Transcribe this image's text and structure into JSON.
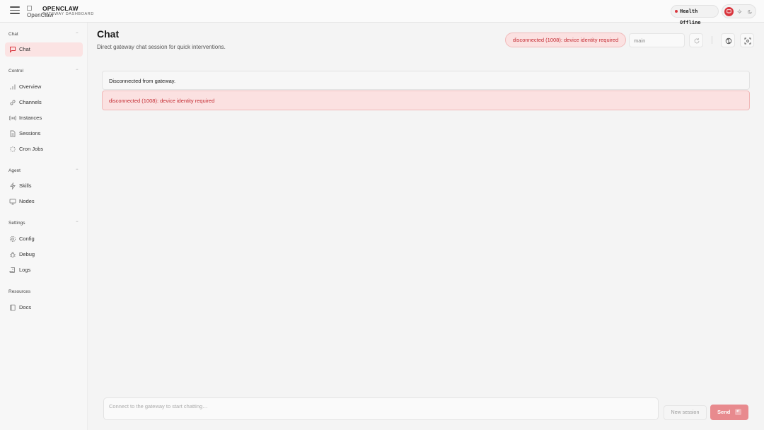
{
  "header": {
    "brand_alt": "OpenClaw",
    "brand_title": "OPENCLAW",
    "brand_subtitle": "GATEWAY DASHBOARD",
    "health_label": "Health Offline"
  },
  "sidebar": {
    "groups": [
      {
        "label": "Chat",
        "chevron": "−"
      },
      {
        "label": "Control",
        "chevron": "−"
      },
      {
        "label": "Agent",
        "chevron": "−"
      },
      {
        "label": "Settings",
        "chevron": "−"
      },
      {
        "label": "Resources"
      }
    ],
    "items": [
      {
        "label": "Chat",
        "icon": "message-square-icon",
        "active": true
      },
      {
        "label": "Overview",
        "icon": "bar-chart-icon"
      },
      {
        "label": "Channels",
        "icon": "link-icon"
      },
      {
        "label": "Instances",
        "icon": "radio-icon"
      },
      {
        "label": "Sessions",
        "icon": "file-text-icon"
      },
      {
        "label": "Cron Jobs",
        "icon": "loader-icon"
      },
      {
        "label": "Skills",
        "icon": "zap-icon"
      },
      {
        "label": "Nodes",
        "icon": "monitor-icon"
      },
      {
        "label": "Config",
        "icon": "settings-icon"
      },
      {
        "label": "Debug",
        "icon": "bug-icon"
      },
      {
        "label": "Logs",
        "icon": "scroll-icon"
      },
      {
        "label": "Docs",
        "icon": "book-icon"
      }
    ]
  },
  "main": {
    "title": "Chat",
    "subtitle": "Direct gateway chat session for quick interventions.",
    "status_chip": "disconnected (1008): device identity required",
    "session_value": "main",
    "messages": {
      "info": "Disconnected from gateway.",
      "error": "disconnected (1008): device identity required"
    },
    "compose_placeholder": "Connect to the gateway to start chatting…",
    "new_session_label": "New session",
    "send_label": "Send",
    "send_kbd": "↵"
  },
  "colors": {
    "accent": "#d9363e",
    "accent_soft": "#fbe1e1",
    "send_disabled": "#e88a8e"
  }
}
